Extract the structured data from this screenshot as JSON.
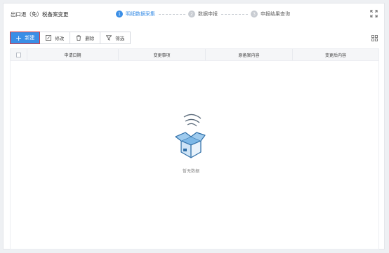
{
  "header": {
    "title": "出口退（免）税备案变更",
    "steps": [
      {
        "num": "1",
        "label": "明细数据采集"
      },
      {
        "num": "2",
        "label": "数据申报"
      },
      {
        "num": "3",
        "label": "申报结果查询"
      }
    ]
  },
  "toolbar": {
    "new_label": "新建",
    "edit_label": "修改",
    "delete_label": "删除",
    "filter_label": "筛选"
  },
  "table": {
    "columns": [
      "申请日期",
      "变更事项",
      "原备案内容",
      "变更后内容"
    ]
  },
  "empty": {
    "text": "暂无数据"
  },
  "colors": {
    "accent": "#3a8ee6",
    "highlight_border": "#e0373a",
    "inactive_step": "#c8ccd2"
  },
  "icons": {
    "fullscreen": "expand-icon",
    "edit": "edit-icon",
    "delete": "trash-icon",
    "filter": "filter-icon",
    "columns": "grid-icon",
    "empty": "empty-box-icon"
  }
}
